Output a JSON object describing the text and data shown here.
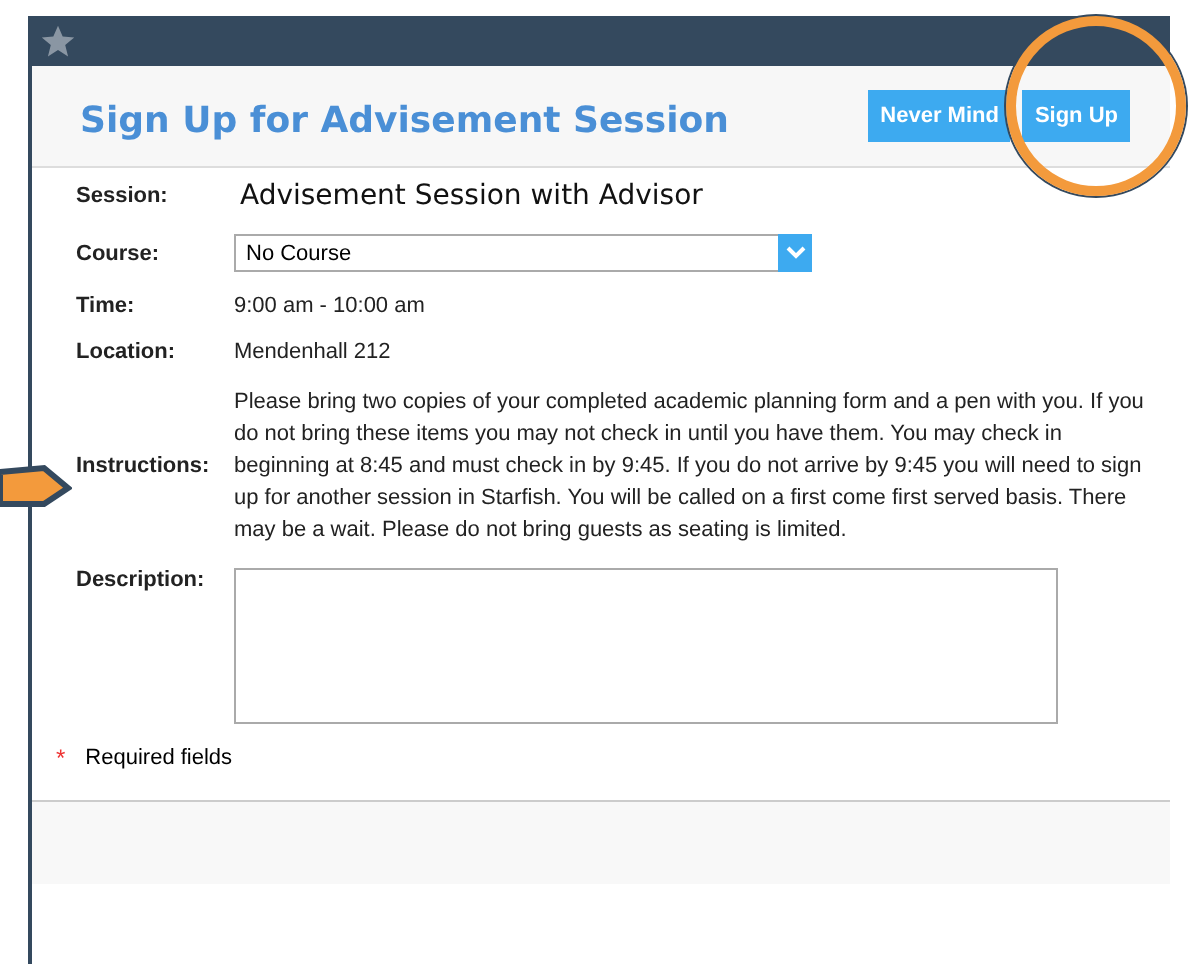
{
  "dialog": {
    "title": "Sign Up for Advisement Session",
    "buttons": [
      {
        "label": "Never Mind"
      },
      {
        "label": "Sign Up"
      }
    ],
    "fields": [
      {
        "label": "Session:",
        "kind": "heading",
        "value": "Advisement Session with Advisor"
      },
      {
        "label": "Course:",
        "kind": "select",
        "value": "No Course"
      },
      {
        "label": "Time:",
        "kind": "text",
        "value": "9:00 am - 10:00 am"
      },
      {
        "label": "Location:",
        "kind": "text",
        "value": "Mendenhall 212"
      },
      {
        "label": "Instructions:",
        "kind": "paragraph",
        "value": "Please bring two copies of your completed academic planning form and a pen with you. If you do not bring these items you may not check in until you have them. You may check in beginning at 8:45 and must check in by 9:45. If you do not arrive by 9:45 you will need to sign up for another session in Starfish. You will be called on a first come first served basis. There may be a wait. Please do not bring guests as seating is limited."
      },
      {
        "label": "Description:",
        "kind": "textarea"
      }
    ],
    "required_note": {
      "marker": "*",
      "text": "Required fields"
    }
  }
}
